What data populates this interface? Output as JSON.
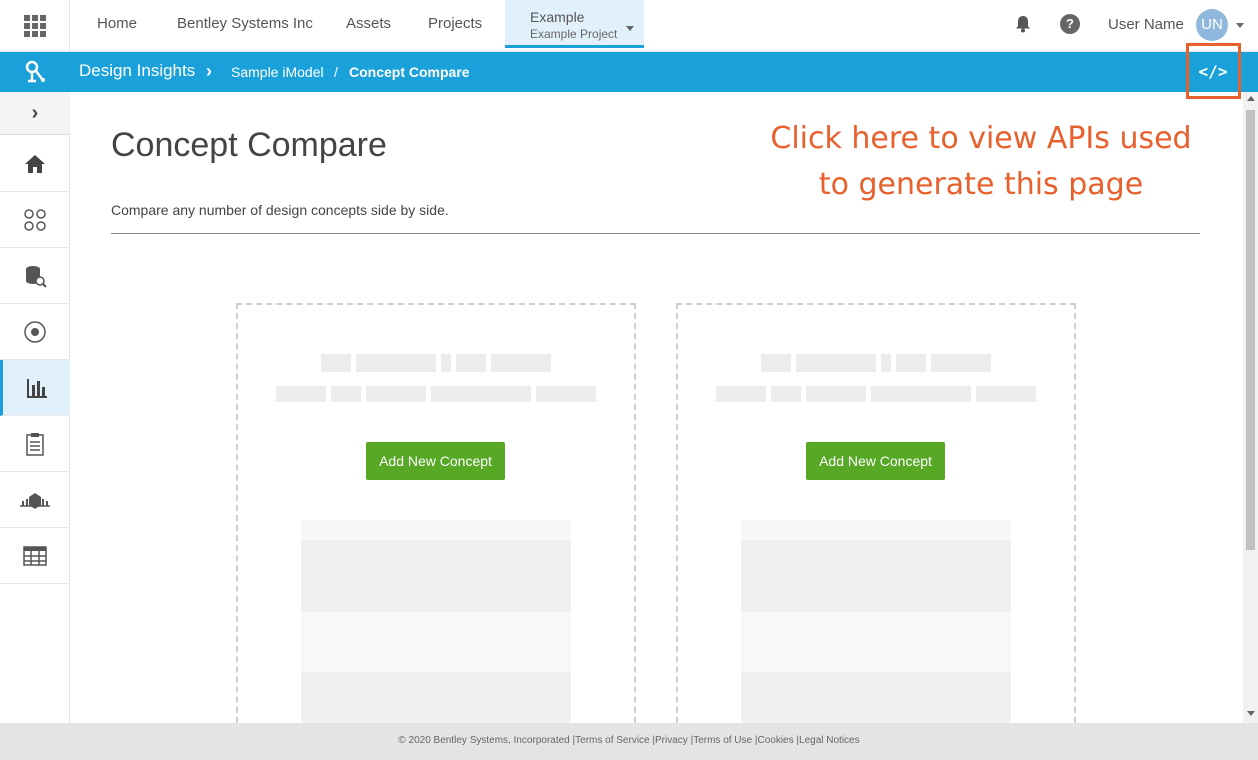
{
  "topnav": {
    "links": [
      "Home",
      "Bentley Systems Inc",
      "Assets",
      "Projects"
    ],
    "active_tab": {
      "title": "Example",
      "subtitle": "Example Project"
    },
    "user_name": "User Name",
    "avatar_initials": "UN",
    "help_label": "?"
  },
  "bluebar": {
    "app_title": "Design Insights",
    "model": "Sample iModel",
    "separator": "/",
    "page": "Concept Compare",
    "code_label": "</>"
  },
  "sidebar": {
    "icons": [
      "home-icon",
      "concepts-icon",
      "data-search-icon",
      "settings-icon",
      "bar-chart-icon",
      "clipboard-icon",
      "carbon-icon",
      "table-icon"
    ],
    "active_index": 4
  },
  "main": {
    "title": "Concept Compare",
    "description": "Compare any number of design concepts side by side.",
    "callout": "Click here to view APIs used to generate this page",
    "cards": [
      {
        "button": "Add New Concept"
      },
      {
        "button": "Add New Concept"
      }
    ]
  },
  "footer": {
    "copyright": "© 2020 Bentley Systems, Incorporated",
    "links": [
      "Terms of Service",
      "Privacy",
      "Terms of Use",
      "Cookies",
      "Legal Notices"
    ]
  },
  "colors": {
    "accent": "#1aa1d9",
    "callout": "#e8602c",
    "button": "#56a825"
  }
}
